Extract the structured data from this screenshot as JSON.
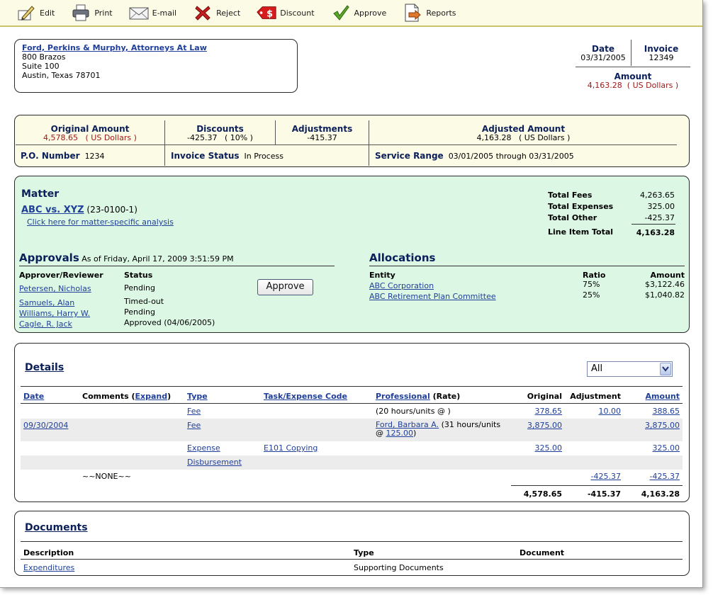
{
  "toolbar": {
    "items": [
      {
        "label": "Edit",
        "icon": "edit-icon"
      },
      {
        "label": "Print",
        "icon": "printer-icon"
      },
      {
        "label": "E-mail",
        "icon": "envelope-icon"
      },
      {
        "label": "Reject",
        "icon": "x-icon"
      },
      {
        "label": "Discount",
        "icon": "price-tag-icon"
      },
      {
        "label": "Approve",
        "icon": "checkmark-icon"
      },
      {
        "label": "Reports",
        "icon": "report-icon"
      }
    ]
  },
  "address": {
    "firm": "Ford, Perkins & Murphy, Attorneys At Law",
    "line1": "800 Brazos",
    "line2": "Suite 100",
    "line3": "Austin, Texas 78701"
  },
  "header": {
    "date_label": "Date",
    "date": "03/31/2005",
    "invoice_label": "Invoice",
    "invoice": "12349",
    "amount_label": "Amount",
    "amount": "4,163.28  ( US Dollars )"
  },
  "summary": {
    "original_label": "Original Amount",
    "original": "4,578.65   ( US Dollars )",
    "discounts_label": "Discounts",
    "discounts": "-425.37   ( 10% )",
    "adjustments_label": "Adjustments",
    "adjustments": "-415.37",
    "adjusted_label": "Adjusted Amount",
    "adjusted": "4,163.28   ( US Dollars )",
    "po_label": "P.O. Number",
    "po": "1234",
    "status_label": "Invoice Status",
    "status": "In Process",
    "service_label": "Service Range",
    "service": "03/01/2005 through 03/31/2005"
  },
  "matter": {
    "heading": "Matter",
    "name": "ABC vs. XYZ",
    "code": "(23-0100-1)",
    "analysis_link": "Click here for matter-specific analysis",
    "totals": [
      {
        "label": "Total Fees",
        "value": "4,263.65"
      },
      {
        "label": "Total Expenses",
        "value": "325.00"
      },
      {
        "label": "Total Other",
        "value": "-425.37"
      },
      {
        "label": "Line Item Total",
        "value": "4,163.28"
      }
    ]
  },
  "approvals": {
    "heading": "Approvals",
    "as_of": "As of Friday, April 17, 2009 3:51:59 PM",
    "col_approver": "Approver/Reviewer",
    "col_status": "Status",
    "approve_button": "Approve",
    "rows": [
      {
        "name": "Petersen, Nicholas",
        "status": "Pending"
      },
      {
        "name": "Samuels, Alan",
        "status": "Timed-out"
      },
      {
        "name": "Williams, Harry W.",
        "status": "Pending"
      },
      {
        "name": "Cagle, R. Jack",
        "status": "Approved (04/06/2005)"
      }
    ]
  },
  "allocations": {
    "heading": "Allocations",
    "col_entity": "Entity",
    "col_ratio": "Ratio",
    "col_amount": "Amount",
    "rows": [
      {
        "entity": "ABC Corporation",
        "ratio": "75%",
        "amount": "$3,122.46"
      },
      {
        "entity": "ABC Retirement Plan Committee",
        "ratio": "25%",
        "amount": "$1,040.82"
      }
    ]
  },
  "details": {
    "heading": "Details",
    "filter": "All",
    "columns": {
      "date": "Date",
      "comments": "Comments",
      "expand": "Expand",
      "type": "Type",
      "task": "Task/Expense Code",
      "professional": "Professional",
      "rate": "(Rate)",
      "original": "Original",
      "adjustment": "Adjustment",
      "amount": "Amount"
    },
    "rows": [
      {
        "date": "",
        "comments": "",
        "type": "Fee",
        "task": "",
        "professional": "",
        "prof_note": "(20 hours/units @ )",
        "rate_link": "",
        "rate_close": "",
        "original": "378.65",
        "adjustment": "10.00",
        "amount": "388.65"
      },
      {
        "date": "09/30/2004",
        "comments": "",
        "type": "Fee",
        "task": "",
        "professional": "Ford, Barbara A.",
        "prof_note": " (31 hours/units",
        "rate_prefix": "@ ",
        "rate_link": "125.00",
        "rate_close": ")",
        "original": "3,875.00",
        "adjustment": "",
        "amount": "3,875.00"
      },
      {
        "date": "",
        "comments": "",
        "type": "Expense",
        "task": "E101 Copying",
        "professional": "",
        "prof_note": "",
        "rate_link": "",
        "rate_close": "",
        "original": "325.00",
        "adjustment": "",
        "amount": "325.00"
      },
      {
        "date": "",
        "comments": "",
        "type": "Disbursement",
        "task": "",
        "professional": "",
        "prof_note": "",
        "rate_link": "",
        "rate_close": "",
        "original": "",
        "adjustment": "",
        "amount": ""
      },
      {
        "date": "",
        "comments": "~~NONE~~",
        "type": "",
        "task": "",
        "professional": "",
        "prof_note": "",
        "rate_link": "",
        "rate_close": "",
        "original": "",
        "adjustment": "-425.37",
        "amount": "-425.37"
      }
    ],
    "totals": {
      "original": "4,578.65",
      "adjustment": "-415.37",
      "amount": "4,163.28"
    }
  },
  "documents": {
    "heading": "Documents",
    "col_description": "Description",
    "col_type": "Type",
    "col_document": "Document",
    "rows": [
      {
        "description": "Expenditures",
        "type": "Supporting Documents",
        "document": ""
      }
    ]
  },
  "colors": {
    "navy": "#0b1f5a",
    "link": "#1f3f99",
    "red_amount": "#a01818",
    "yellow_panel": "#fcfbe6",
    "green_panel": "#dcf7e4"
  }
}
